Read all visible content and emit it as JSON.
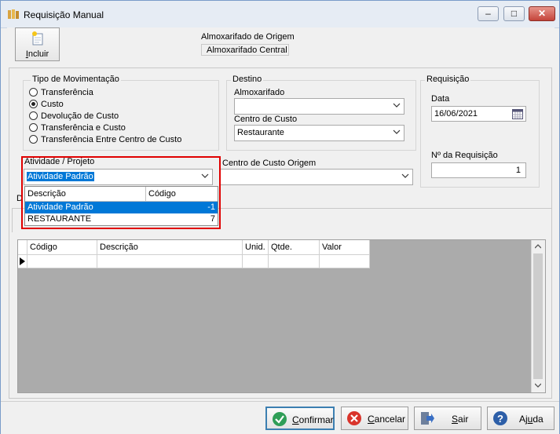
{
  "window": {
    "title": "Requisição Manual",
    "min": "–",
    "max": "□",
    "close": "✕"
  },
  "toolbar": {
    "incluir_first": "I",
    "incluir_rest": "ncluir"
  },
  "origem": {
    "label": "Almoxarifado de Origem",
    "value": "Almoxarifado Central"
  },
  "movimentacao": {
    "label": "Tipo de Movimentação",
    "options": [
      "Transferência",
      "Custo",
      "Devolução de Custo",
      "Transferência e Custo",
      "Transferência Entre Centro de Custo"
    ],
    "selected": "Custo"
  },
  "destino": {
    "label": "Destino",
    "almox_label": "Almoxarifado",
    "almox_value": "",
    "centro_label": "Centro de Custo",
    "centro_value": "Restaurante"
  },
  "requisicao": {
    "label": "Requisição",
    "data_label": "Data",
    "data_value": "16/06/2021",
    "numero_label": "Nº  da Requisição",
    "numero_value": "1"
  },
  "atividade": {
    "label": "Atividade / Projeto",
    "value": "Atividade Padrão",
    "columns": [
      "Descrição",
      "Código"
    ],
    "rows": [
      {
        "descricao": "Atividade Padrão",
        "codigo": "-1",
        "selected": true
      },
      {
        "descricao": "RESTAURANTE",
        "codigo": "7",
        "selected": false
      }
    ]
  },
  "centro_origem": {
    "label": "Centro de Custo Origem",
    "value": ""
  },
  "tab_label_fragment": "D",
  "grid": {
    "columns": [
      "Código",
      "Descrição",
      "Unid.",
      "Qtde.",
      "Valor"
    ]
  },
  "footer": {
    "confirmar_first": "C",
    "confirmar_rest": "onfirmar",
    "cancelar_first": "C",
    "cancelar_rest": "ancelar",
    "sair_first": "S",
    "sair_rest": "air",
    "ajuda_first": "Aj",
    "ajuda_u": "u",
    "ajuda_rest": "da"
  },
  "colors": {
    "highlight": "#0078d7",
    "annotation": "#e00000"
  }
}
